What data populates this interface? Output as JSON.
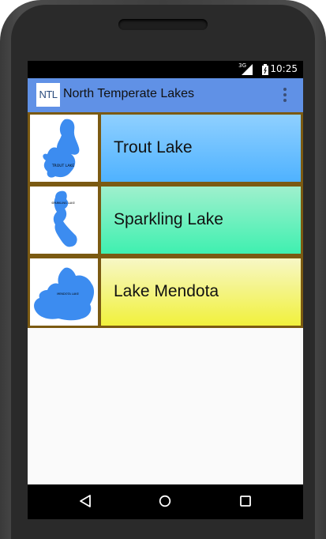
{
  "status_bar": {
    "network": "3G",
    "time": "10:25"
  },
  "action_bar": {
    "icon_text": "NTL",
    "title": "North Temperate Lakes"
  },
  "lakes": [
    {
      "name": "Trout Lake",
      "map_label": "TROUT LAKE"
    },
    {
      "name": "Sparkling Lake",
      "map_label": "SPARKLING LAKE"
    },
    {
      "name": "Lake Mendota",
      "map_label": "MENDOTA LAKE"
    }
  ],
  "colors": {
    "action_bar": "#6091e6",
    "row_border": "#7b5a12",
    "trout_panel": "#4fb2ff",
    "sparkling_panel": "#3ff0b0",
    "mendota_panel": "#f1f13c",
    "lake_water": "#3c8cf0"
  },
  "icons": {
    "nav": [
      "back-icon",
      "home-icon",
      "recent-apps-icon"
    ],
    "menu": "overflow-menu-icon"
  }
}
